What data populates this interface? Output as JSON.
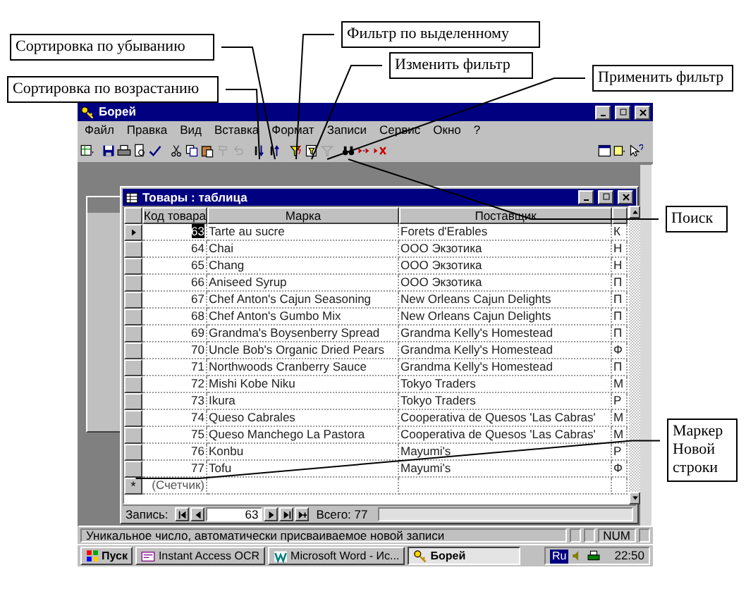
{
  "callouts": [
    {
      "text": "Сортировка по убыванию"
    },
    {
      "text": "Сортировка по возрастанию"
    },
    {
      "text": "Фильтр по выделенному"
    },
    {
      "text": "Изменить фильтр"
    },
    {
      "text": "Применить фильтр"
    },
    {
      "text": "Поиск"
    },
    {
      "text": "Маркер Новой строки"
    }
  ],
  "window": {
    "title": "Борей"
  },
  "menu": [
    "Файл",
    "Правка",
    "Вид",
    "Вставка",
    "Формат",
    "Записи",
    "Сервис",
    "Окно",
    "?"
  ],
  "toolbar": [
    {
      "kind": "view",
      "disabled": false
    },
    {
      "kind": "save",
      "disabled": false
    },
    {
      "kind": "print",
      "disabled": false
    },
    {
      "kind": "preview",
      "disabled": false
    },
    {
      "kind": "spelling",
      "disabled": false
    },
    {
      "kind": "cut",
      "disabled": false
    },
    {
      "kind": "copy",
      "disabled": false
    },
    {
      "kind": "paste",
      "disabled": false
    },
    {
      "kind": "format-painter",
      "disabled": true
    },
    {
      "kind": "undo",
      "disabled": true
    },
    {
      "kind": "sort-ascending",
      "disabled": false
    },
    {
      "kind": "sort-descending",
      "disabled": false
    },
    {
      "kind": "filter-selection",
      "disabled": false
    },
    {
      "kind": "filter-form",
      "disabled": false
    },
    {
      "kind": "apply-filter",
      "disabled": true
    },
    {
      "kind": "find",
      "disabled": false
    },
    {
      "kind": "new-record",
      "disabled": false
    },
    {
      "kind": "delete-record",
      "disabled": false
    },
    {
      "kind": "database-window",
      "disabled": false
    },
    {
      "kind": "new-object",
      "disabled": false
    },
    {
      "kind": "help",
      "disabled": false
    }
  ],
  "table_window": {
    "title": "Товары : таблица",
    "columns": [
      "Код товара",
      "Марка",
      "Поставщик"
    ],
    "rows": [
      {
        "id": "63",
        "name": "Tarte au sucre",
        "supplier": "Forets d'Erables",
        "column_4": "К",
        "current": true
      },
      {
        "id": "64",
        "name": "Chai",
        "supplier": "ООО Экзотика",
        "column_4": "Н",
        "current": false
      },
      {
        "id": "65",
        "name": "Chang",
        "supplier": "ООО Экзотика",
        "column_4": "Н",
        "current": false
      },
      {
        "id": "66",
        "name": "Aniseed Syrup",
        "supplier": "ООО Экзотика",
        "column_4": "П",
        "current": false
      },
      {
        "id": "67",
        "name": "Chef Anton's Cajun Seasoning",
        "supplier": "New Orleans Cajun Delights",
        "column_4": "П",
        "current": false
      },
      {
        "id": "68",
        "name": "Chef Anton's Gumbo Mix",
        "supplier": "New Orleans Cajun Delights",
        "column_4": "П",
        "current": false
      },
      {
        "id": "69",
        "name": "Grandma's Boysenberry Spread",
        "supplier": "Grandma Kelly's Homestead",
        "column_4": "П",
        "current": false
      },
      {
        "id": "70",
        "name": "Uncle Bob's Organic Dried Pears",
        "supplier": "Grandma Kelly's Homestead",
        "column_4": "Ф",
        "current": false
      },
      {
        "id": "71",
        "name": "Northwoods Cranberry Sauce",
        "supplier": "Grandma Kelly's Homestead",
        "column_4": "П",
        "current": false
      },
      {
        "id": "72",
        "name": "Mishi Kobe Niku",
        "supplier": "Tokyo Traders",
        "column_4": "М",
        "current": false
      },
      {
        "id": "73",
        "name": "Ikura",
        "supplier": "Tokyo Traders",
        "column_4": "Р",
        "current": false
      },
      {
        "id": "74",
        "name": "Queso Cabrales",
        "supplier": "Cooperativa de Quesos 'Las Cabras'",
        "column_4": "М",
        "current": false
      },
      {
        "id": "75",
        "name": "Queso Manchego La Pastora",
        "supplier": "Cooperativa de Quesos 'Las Cabras'",
        "column_4": "М",
        "current": false
      },
      {
        "id": "76",
        "name": "Konbu",
        "supplier": "Mayumi's",
        "column_4": "Р",
        "current": false
      },
      {
        "id": "77",
        "name": "Tofu",
        "supplier": "Mayumi's",
        "column_4": "Ф",
        "current": false
      }
    ],
    "new_row": {
      "marker": "*",
      "id": "(Счетчик)"
    },
    "navigation": {
      "label": "Запись:",
      "current": "63",
      "total": "Всего: 77"
    }
  },
  "status_bar": {
    "text": "Уникальное число, автоматически присваиваемое новой записи",
    "indicator": "NUM"
  },
  "taskbar": {
    "start": "Пуск",
    "tasks": [
      {
        "label": "Instant Access OCR",
        "selected": false
      },
      {
        "label": "Microsoft Word - Ис...",
        "selected": false
      },
      {
        "label": "Борей",
        "selected": true
      }
    ],
    "language": "Ru",
    "clock": "22:50"
  }
}
